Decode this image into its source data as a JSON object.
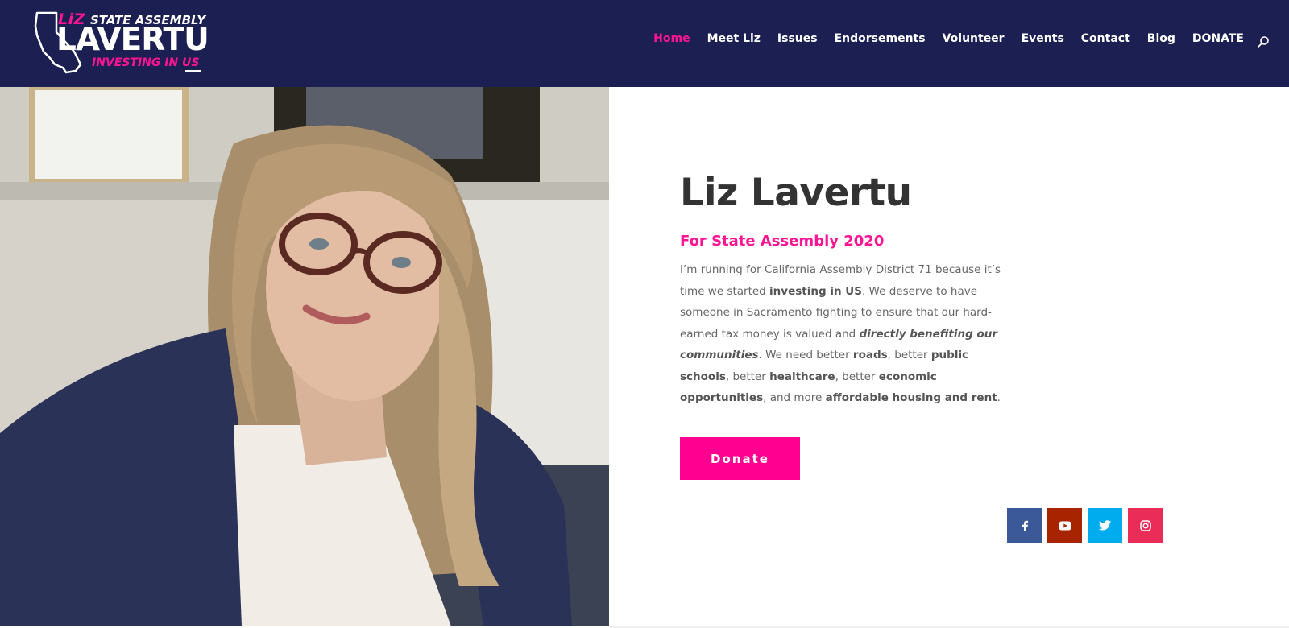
{
  "header": {
    "logo": {
      "liz": "LiZ",
      "state_assembly": "STATE ASSEMBLY",
      "name": "LAVERTU",
      "tagline": "INVESTING IN US"
    },
    "nav": [
      {
        "label": "Home",
        "active": true
      },
      {
        "label": "Meet Liz",
        "active": false
      },
      {
        "label": "Issues",
        "active": false
      },
      {
        "label": "Endorsements",
        "active": false
      },
      {
        "label": "Volunteer",
        "active": false
      },
      {
        "label": "Events",
        "active": false
      },
      {
        "label": "Contact",
        "active": false
      },
      {
        "label": "Blog",
        "active": false
      },
      {
        "label": "DONATE",
        "active": false
      }
    ],
    "search_icon": "search-icon"
  },
  "hero": {
    "title": "Liz Lavertu",
    "subtitle": "For State Assembly 2020",
    "body": {
      "t1": "I’m running for California Assembly District 71 because it’s time we started ",
      "b1": "investing in US",
      "t2": ". We deserve to have someone in Sacramento fighting to ensure that our hard-earned tax money is valued and ",
      "bi1": "directly benefiting our communities",
      "t3": ". We need better ",
      "b2": "roads",
      "t4": ", better ",
      "b3": "public schools",
      "t5": ", better ",
      "b4": "healthcare",
      "t6": ", better ",
      "b5": "economic opportunities",
      "t7": ", and more ",
      "b6": "affordable housing and rent",
      "t8": "."
    },
    "donate_label": "Donate"
  },
  "social": [
    {
      "name": "facebook",
      "glyph": "f",
      "color": "#3b5998"
    },
    {
      "name": "youtube",
      "glyph": "▶",
      "color": "#a82400"
    },
    {
      "name": "twitter",
      "glyph": "t",
      "color": "#00aced"
    },
    {
      "name": "instagram",
      "glyph": "◎",
      "color": "#ea2c59"
    }
  ],
  "colors": {
    "header_bg": "#1b1f52",
    "accent": "#ff1493",
    "donate_bg": "#ff0090",
    "title": "#333333"
  }
}
